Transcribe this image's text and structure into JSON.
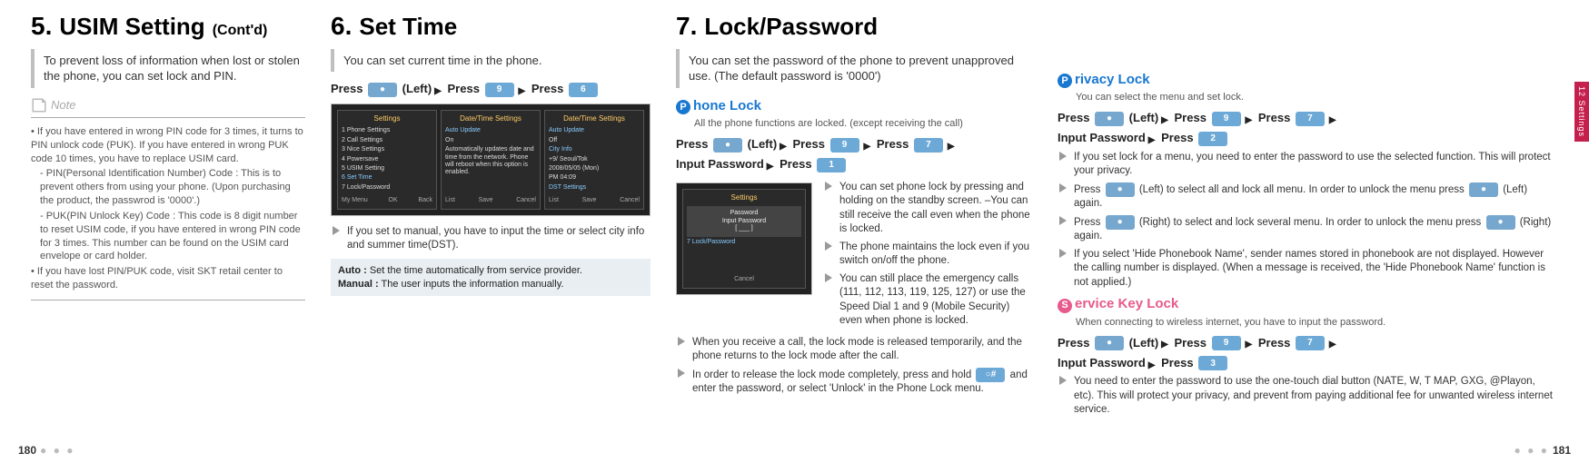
{
  "page": {
    "left": "180",
    "right": "181",
    "sideTab": "12  Settings"
  },
  "sec5": {
    "num": "5.",
    "title": "USIM Setting",
    "contd": "(Cont'd)",
    "intro": "To prevent loss of information when lost or stolen the phone, you can set lock and PIN.",
    "noteLabel": "Note",
    "notes": {
      "n1": "• If you have entered in wrong PIN code for 3 times, it turns to PIN unlock code (PUK). If you have entered in wrong PUK code 10 times, you have to replace USIM card.",
      "n2": "- PIN(Personal Identification Number) Code : This is to prevent others from using your phone. (Upon purchasing the product, the passwrod is '0000'.)",
      "n3": "- PUK(PIN Unlock Key) Code : This code is 8 digit number to reset USIM code, if you have entered in wrong PIN code for 3 times. This number can be found on the USIM card envelope or card holder.",
      "n4": "• If you have lost PIN/PUK code, visit SKT retail center to reset the password."
    }
  },
  "sec6": {
    "num": "6.",
    "title": "Set Time",
    "intro": "You can set current time in the phone.",
    "press": {
      "p1": "Press",
      "p2": "(Left)",
      "p3": "Press",
      "p4": "Press",
      "key1": "●",
      "key2": "9",
      "key3": "6"
    },
    "shot": {
      "a": {
        "hd": "Settings",
        "r1": "1 Phone Settings",
        "r2": "2 Call Settings",
        "r3": "3 Nice Settings",
        "r4": "4 Powersave",
        "r5": "5 USIM Setting",
        "r6": "6 Set Time",
        "r7": "7 Lock/Password",
        "sb1": "My Menu",
        "sb2": "OK",
        "sb3": "Back"
      },
      "b": {
        "hd": "Date/Time Settings",
        "r1": "Auto Update",
        "r2": "On",
        "r3": "Automatically updates date and time from the network. Phone will reboot when this option is enabled.",
        "sb1": "List",
        "sb2": "Save",
        "sb3": "Cancel"
      },
      "c": {
        "hd": "Date/Time Settings",
        "r1": "Auto Update",
        "r2": "Off",
        "r3": "City Info",
        "r4": "+9/ Seoul/Tok",
        "r5": "2008/05/05 (Mon)",
        "r6": "PM 04:09",
        "r7": "DST Settings",
        "sb1": "List",
        "sb2": "Save",
        "sb3": "Cancel"
      }
    },
    "bul1": "If you set to manual, you have to input the time or select city info and summer time(DST).",
    "defs": {
      "autoL": "Auto :",
      "autoV": "Set the time automatically from service provider.",
      "manL": "Manual :",
      "manV": "The user inputs the information manually."
    }
  },
  "sec7": {
    "num": "7.",
    "title": "Lock/Password",
    "intro": "You can set the password of the phone to prevent unapproved use. (The default password is '0000')",
    "phoneLock": {
      "head": "hone Lock",
      "cap": "P",
      "desc": "All the phone functions are locked. (except receiving the call)",
      "press": {
        "p1": "Press",
        "p2": "(Left)",
        "p3": "Press",
        "p4": "Press",
        "p5": "Input Password",
        "p6": "Press",
        "k1": "●",
        "k2": "9",
        "k3": "7",
        "k4": "1"
      },
      "shot": {
        "hd": "Settings",
        "line1": "Password",
        "line2": "Input Password",
        "line3": "[  ___  ]",
        "line4": "7 Lock/Password",
        "sb": "Cancel"
      },
      "b1": "You can set phone lock by pressing and holding        on the standby screen. –You can still receive the call even when the phone is locked.",
      "b2": "The phone maintains the lock even if you switch on/off the phone.",
      "b3": "You can still place the emergency calls (111, 112, 113, 119, 125, 127) or use the Speed Dial 1 and 9 (Mobile Security) even when phone is locked.",
      "b4": "When you receive a call, the lock mode is released temporarily, and the phone returns to the lock mode after the call.",
      "b5a": "In order to release the lock mode completely, press and hold",
      "b5b": "and enter the password, or select 'Unlock' in the Phone Lock menu.",
      "holdKey": "○#"
    },
    "privacy": {
      "head": "rivacy Lock",
      "cap": "P",
      "desc": "You can select the menu and set lock.",
      "press": {
        "p1": "Press",
        "p2": "(Left)",
        "p3": "Press",
        "p4": "Press",
        "p5": "Input Password",
        "p6": "Press",
        "k1": "●",
        "k2": "9",
        "k3": "7",
        "k4": "2"
      },
      "b1": "If you set lock for a menu, you need to enter the password to use the selected function. This will protect your privacy.",
      "b2a": "Press",
      "b2b": "(Left) to select all and lock all menu. In order to unlock the menu press",
      "b2c": "(Left) again.",
      "b3a": "Press",
      "b3b": "(Right) to select and lock several menu. In order to unlock the menu press",
      "b3c": "(Right) again.",
      "b4": "If you select 'Hide Phonebook Name', sender names stored in phonebook are not displayed. However the calling number is displayed. (When a message is received, the 'Hide Phonebook Name' function is not applied.)"
    },
    "svcKey": {
      "head": "ervice Key Lock",
      "cap": "S",
      "desc": "When connecting to wireless internet, you have to input the password.",
      "press": {
        "p1": "Press",
        "p2": "(Left)",
        "p3": "Press",
        "p4": "Press",
        "p5": "Input Password",
        "p6": "Press",
        "k1": "●",
        "k2": "9",
        "k3": "7",
        "k4": "3"
      },
      "b1": "You need to enter the password to use the one-touch dial button (NATE, W, T MAP, GXG, @Playon, etc). This will protect your privacy, and prevent from paying additional fee for unwanted wireless internet service."
    }
  }
}
